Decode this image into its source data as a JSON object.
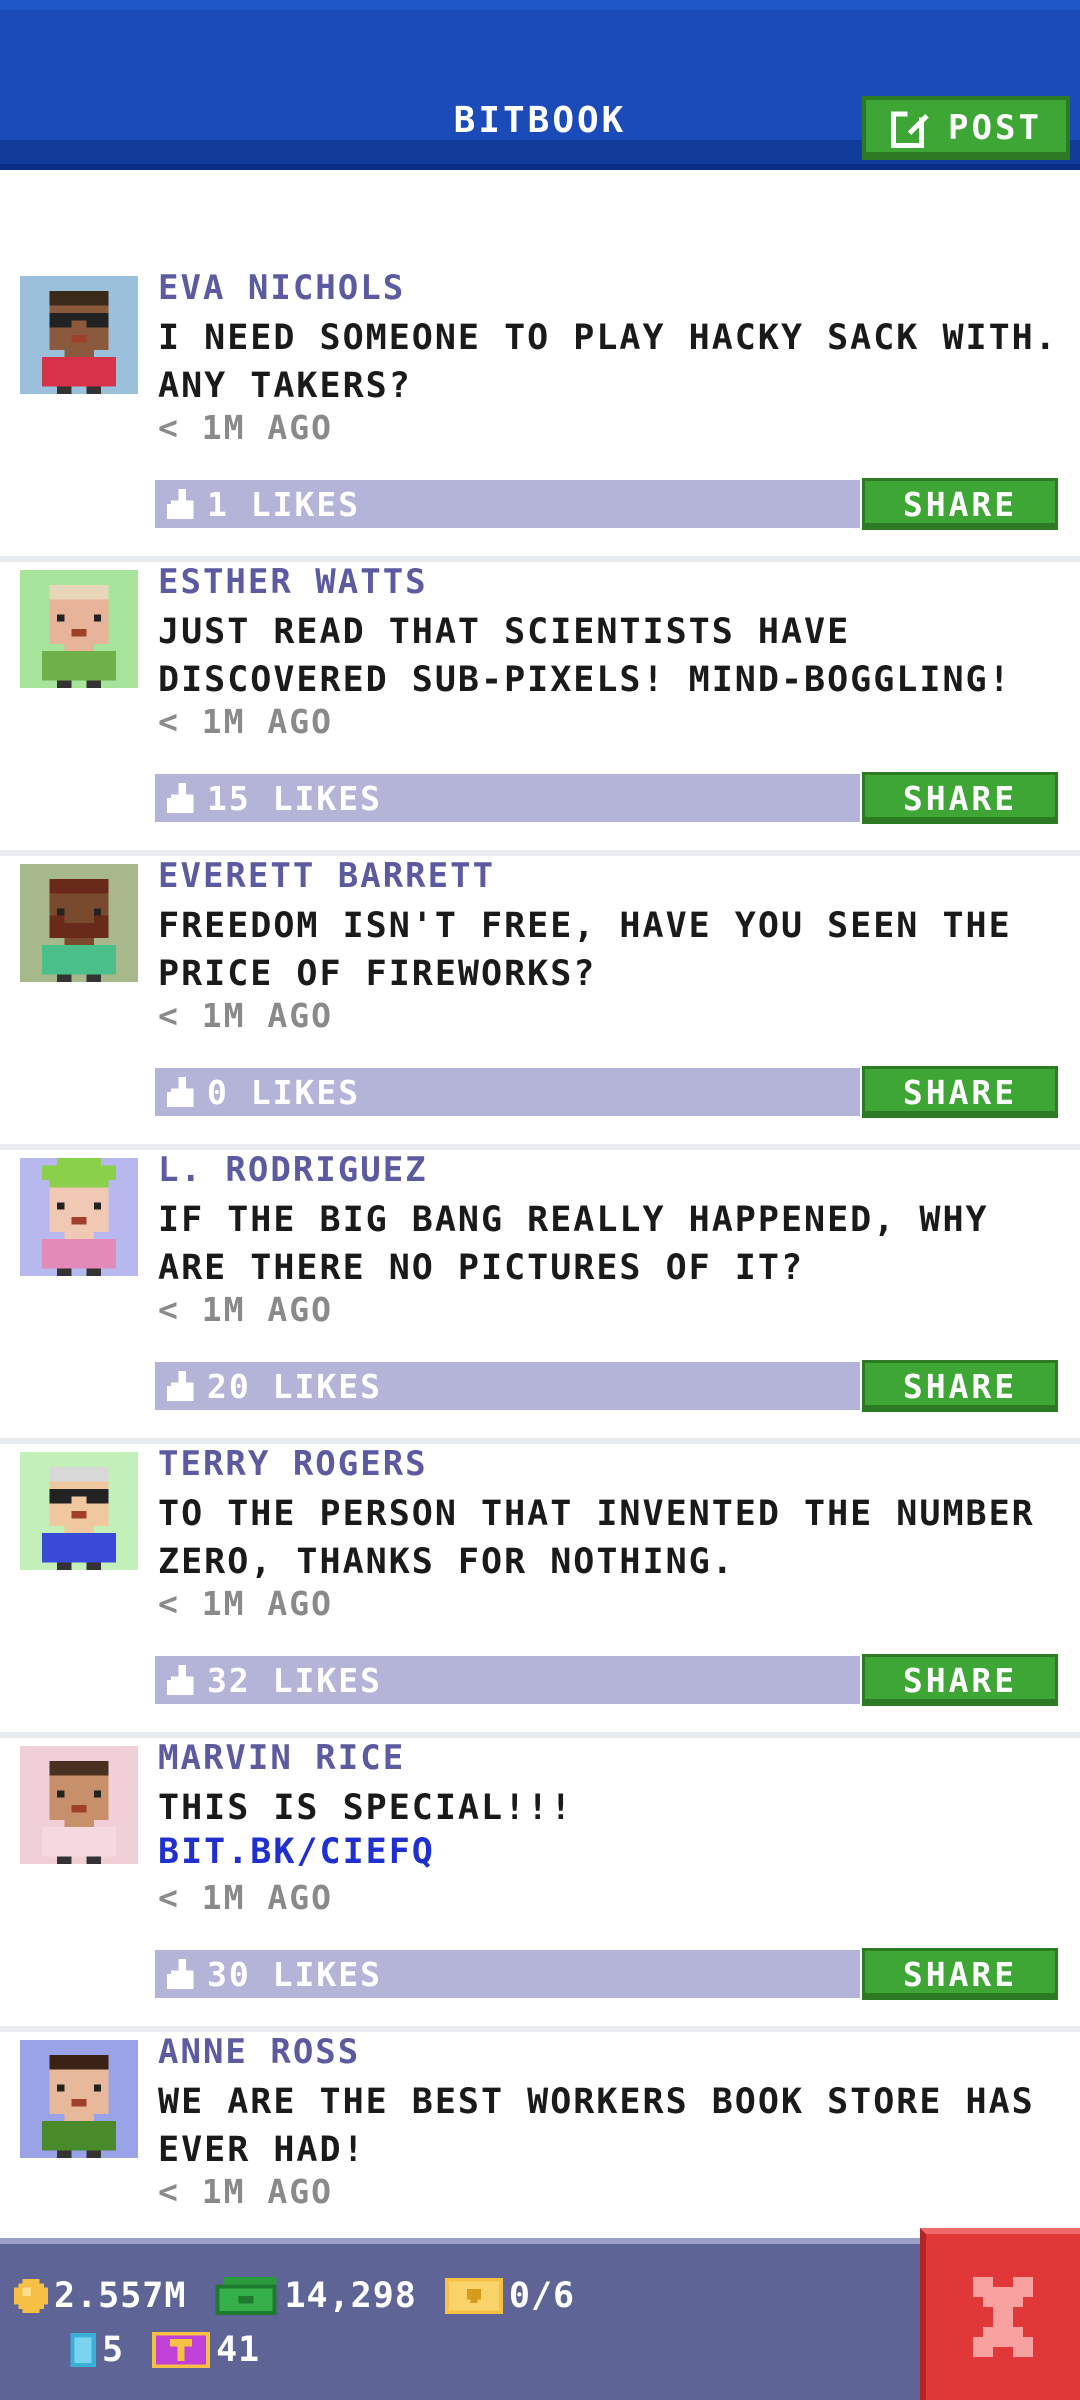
{
  "header": {
    "title": "BITBOOK",
    "post_label": "POST"
  },
  "share_label": "SHARE",
  "posts": [
    {
      "name": "EVA NICHOLS",
      "text": "I NEED SOMEONE TO PLAY HACKY SACK WITH. ANY TAKERS?",
      "time": "< 1M AGO",
      "likes": "1 LIKES",
      "avatar": {
        "bg": "#9bc0dc",
        "skin": "#8b5a3c",
        "hair": "#3a2a1a",
        "shirt": "#d8324a",
        "accessory": "glasses"
      }
    },
    {
      "name": "ESTHER WATTS",
      "text": "JUST READ THAT SCIENTISTS HAVE DISCOVERED SUB-PIXELS! MIND-BOGGLING!",
      "time": "< 1M AGO",
      "likes": "15 LIKES",
      "avatar": {
        "bg": "#a6e39b",
        "skin": "#e7b49a",
        "hair": "#e8d6b8",
        "shirt": "#6fb04a",
        "accessory": "none"
      }
    },
    {
      "name": "EVERETT BARRETT",
      "text": "FREEDOM ISN'T FREE, HAVE YOU SEEN THE PRICE OF FIREWORKS?",
      "time": "< 1M AGO",
      "likes": "0 LIKES",
      "avatar": {
        "bg": "#a7b88a",
        "skin": "#7a4a2e",
        "hair": "#6a2a1a",
        "shirt": "#4bbf8a",
        "accessory": "beard"
      }
    },
    {
      "name": "L. RODRIGUEZ",
      "text": "IF THE BIG BANG REALLY HAPPENED, WHY ARE THERE NO PICTURES OF IT?",
      "time": "< 1M AGO",
      "likes": "20 LIKES",
      "avatar": {
        "bg": "#b7b9ee",
        "skin": "#f0c8b4",
        "hair": "#8ad04a",
        "shirt": "#e48ab8",
        "accessory": "hat"
      }
    },
    {
      "name": "TERRY ROGERS",
      "text": "TO THE PERSON THAT INVENTED THE NUMBER ZERO, THANKS FOR NOTHING.",
      "time": "< 1M AGO",
      "likes": "32 LIKES",
      "avatar": {
        "bg": "#c2f0b8",
        "skin": "#f0c8a0",
        "hair": "#d8d8d8",
        "shirt": "#3a4ad8",
        "accessory": "glasses"
      }
    },
    {
      "name": "MARVIN RICE",
      "text": "THIS IS SPECIAL!!!",
      "link": "BIT.BK/CIEFQ",
      "time": "< 1M AGO",
      "likes": "30 LIKES",
      "avatar": {
        "bg": "#f0d0d6",
        "skin": "#c8906a",
        "hair": "#4a3020",
        "shirt": "#f6d8e0",
        "accessory": "none"
      }
    },
    {
      "name": "ANNE ROSS",
      "text": "WE ARE THE BEST WORKERS BOOK STORE HAS EVER HAD!",
      "time": "< 1M AGO",
      "likes": "",
      "avatar": {
        "bg": "#9aa2e8",
        "skin": "#e8b89a",
        "hair": "#3a2214",
        "shirt": "#4a8a2a",
        "accessory": "none"
      }
    }
  ],
  "footer": {
    "coins": "2.557M",
    "cash": "14,298",
    "tickets": "0/6",
    "bux_small": "5",
    "bux": "41"
  },
  "colors": {
    "header_blue": "#1a4bb8",
    "accent_green": "#3da634",
    "name_purple": "#5c5aa0",
    "link_blue": "#1f2fd0",
    "like_bar": "#b3b4d8",
    "footer_bg": "#5e6496",
    "close_red": "#e03838"
  }
}
